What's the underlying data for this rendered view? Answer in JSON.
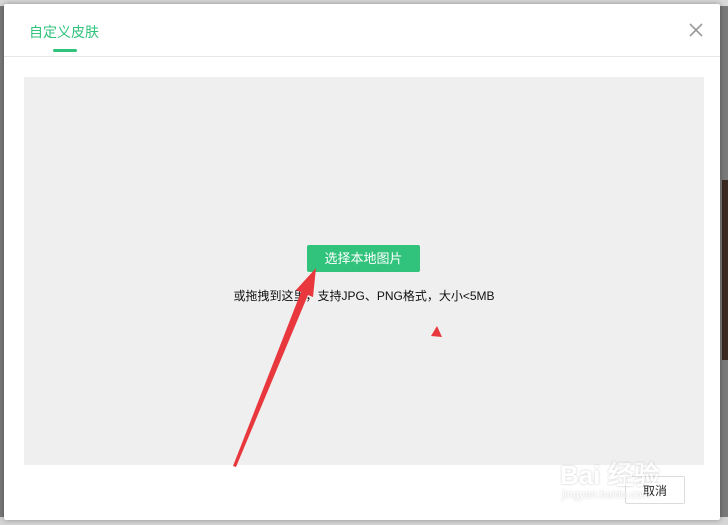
{
  "dialog": {
    "tab_label": "自定义皮肤",
    "close_icon": "close-icon",
    "select_button_label": "选择本地图片",
    "hint_text": "或拖拽到这里，支持JPG、PNG格式，大小<5MB",
    "cancel_label": "取消"
  },
  "watermark": {
    "line1": "Bai 经验",
    "line2": "jingyan.baidu.com"
  },
  "colors": {
    "accent": "#31c27c",
    "annotation_arrow": "#e8383d",
    "drop_zone_bg": "#efefef"
  }
}
